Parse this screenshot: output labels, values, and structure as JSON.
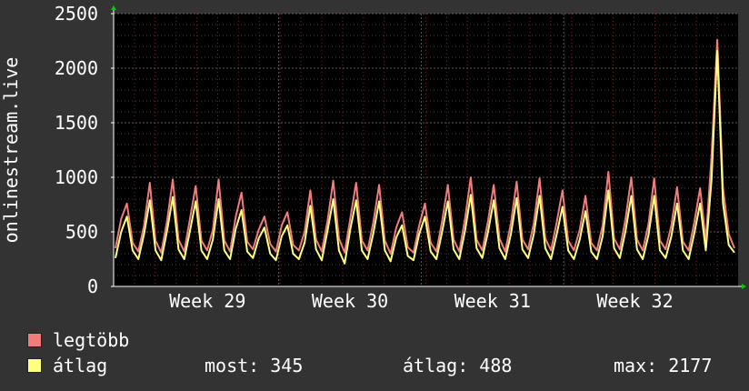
{
  "colors": {
    "background": "#333333",
    "plot_background": "#000000",
    "grid_major": "#5a5a5a",
    "grid_minor": "#8a1c1c",
    "axis": "#ffffff",
    "arrow": "#00cc00",
    "max_series": "#f07c7c",
    "avg_series": "#ffff80"
  },
  "legend": [
    {
      "label": "legtöbb",
      "color": "#f07c7c"
    },
    {
      "label": "átlag",
      "color": "#ffff80"
    }
  ],
  "stats": {
    "current": "most: 345",
    "average": "átlag: 488",
    "maximum": "max: 2177"
  },
  "chart_data": {
    "type": "line",
    "ylabel": "onlinestream.live",
    "xlabel": "",
    "ylim": [
      0,
      2500
    ],
    "yticks": [
      0,
      500,
      1000,
      1500,
      2000,
      2500
    ],
    "x_ticks": [
      "Week 29",
      "Week 30",
      "Week 31",
      "Week 32"
    ],
    "grid": true,
    "series": [
      {
        "name": "legtöbb",
        "color": "#f07c7c",
        "values": [
          350,
          620,
          760,
          400,
          320,
          560,
          950,
          420,
          310,
          600,
          980,
          430,
          320,
          620,
          920,
          420,
          330,
          520,
          980,
          420,
          320,
          640,
          860,
          410,
          340,
          520,
          640,
          390,
          320,
          560,
          680,
          380,
          330,
          500,
          880,
          430,
          320,
          600,
          970,
          440,
          310,
          630,
          950,
          420,
          330,
          590,
          930,
          420,
          300,
          540,
          680,
          360,
          310,
          560,
          760,
          400,
          320,
          600,
          930,
          430,
          320,
          620,
          1000,
          430,
          330,
          600,
          930,
          440,
          320,
          580,
          960,
          430,
          340,
          580,
          990,
          440,
          330,
          590,
          880,
          420,
          330,
          520,
          830,
          400,
          330,
          560,
          1050,
          440,
          340,
          620,
          1000,
          430,
          330,
          570,
          990,
          420,
          340,
          560,
          910,
          410,
          330,
          590,
          900,
          420,
          1200,
          2260,
          900,
          480,
          350
        ]
      },
      {
        "name": "átlag",
        "color": "#ffff80",
        "values": [
          260,
          500,
          640,
          330,
          250,
          480,
          790,
          330,
          240,
          510,
          820,
          340,
          250,
          510,
          780,
          330,
          250,
          430,
          800,
          330,
          250,
          530,
          700,
          320,
          260,
          440,
          540,
          300,
          240,
          460,
          560,
          300,
          250,
          400,
          740,
          340,
          240,
          510,
          800,
          330,
          210,
          530,
          790,
          330,
          250,
          490,
          780,
          330,
          230,
          450,
          560,
          280,
          240,
          480,
          640,
          320,
          250,
          500,
          780,
          340,
          250,
          510,
          840,
          350,
          260,
          500,
          790,
          350,
          250,
          480,
          810,
          340,
          260,
          480,
          830,
          350,
          250,
          480,
          730,
          330,
          250,
          430,
          690,
          320,
          250,
          460,
          880,
          350,
          260,
          510,
          830,
          340,
          250,
          470,
          830,
          330,
          260,
          460,
          760,
          330,
          250,
          490,
          760,
          330,
          980,
          2160,
          760,
          380,
          310
        ]
      }
    ]
  }
}
